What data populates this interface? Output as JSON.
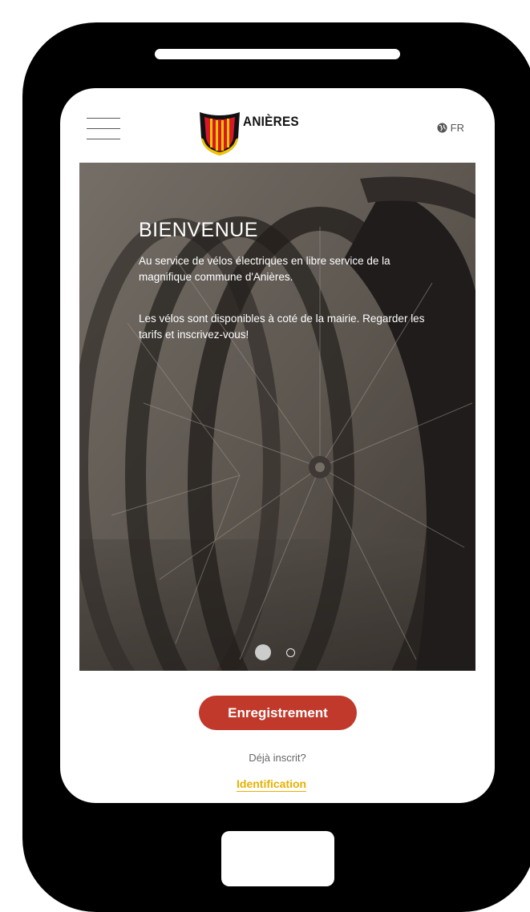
{
  "header": {
    "brand": "ANIÈRES",
    "language": "FR"
  },
  "hero": {
    "title": "BIENVENUE",
    "paragraph1": "Au service de vélos électriques en libre service de la magnifique commune d'Anières.",
    "paragraph2": "Les vélos sont disponibles à coté de la mairie. Regarder les tarifs et inscrivez-vous!",
    "carousel": {
      "slides": 2,
      "active": 1
    }
  },
  "actions": {
    "register_label": "Enregistrement",
    "already_registered": "Déjà inscrit?",
    "login_label": "Identification"
  },
  "colors": {
    "accent_red": "#c0392b",
    "link_yellow": "#e8b100",
    "phone_frame": "#000000"
  },
  "icons": [
    "hamburger-icon",
    "globe-icon",
    "shield-logo"
  ]
}
